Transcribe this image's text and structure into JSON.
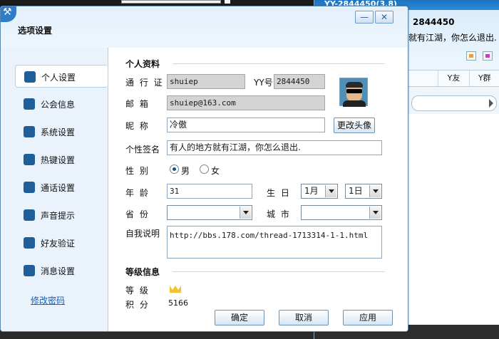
{
  "background": {
    "yy_window": {
      "title": "YY-2844450(3.8)",
      "user_id": "2844450",
      "signature": "就有江湖，你怎么退出.",
      "tabs": [
        "",
        "Y友",
        "Y群"
      ]
    }
  },
  "dialog": {
    "title": "选项设置",
    "minimize_label": "—",
    "close_label": "✕"
  },
  "nav": {
    "items": [
      {
        "label": "个人设置",
        "icon": "person-icon"
      },
      {
        "label": "公会信息",
        "icon": "flag-icon"
      },
      {
        "label": "系统设置",
        "icon": "monitor-icon"
      },
      {
        "label": "热键设置",
        "icon": "key-icon"
      },
      {
        "label": "通话设置",
        "icon": "microphone-icon"
      },
      {
        "label": "声音提示",
        "icon": "speaker-icon"
      },
      {
        "label": "好友验证",
        "icon": "friend-verify-icon"
      },
      {
        "label": "消息设置",
        "icon": "message-icon"
      }
    ],
    "active_index": 0,
    "change_password": "修改密码"
  },
  "profile": {
    "section_title": "个人资料",
    "passport_label": "通 行 证",
    "passport_value": "shuiep",
    "yy_label": "YY号",
    "yy_value": "2844450",
    "email_label": "邮    箱",
    "email_value": "shuiep@163.com",
    "nickname_label": "昵    称",
    "nickname_value": "冷傲",
    "change_avatar_label": "更改头像",
    "signature_label": "个性签名",
    "signature_value": "有人的地方就有江湖，你怎么退出.",
    "gender_label": "性    别",
    "gender_male": "男",
    "gender_female": "女",
    "gender_selected": "男",
    "age_label": "年    龄",
    "age_value": "31",
    "birthday_label": "生  日",
    "birthday_month": "1月",
    "birthday_day": "1日",
    "province_label": "省    份",
    "province_value": "",
    "city_label": "城  市",
    "city_value": "",
    "bio_label": "自我说明",
    "bio_value": "http://bbs.178.com/thread-1713314-1-1.html"
  },
  "level": {
    "section_title": "等级信息",
    "level_label": "等    级",
    "points_label": "积    分",
    "points_value": "5166"
  },
  "buttons": {
    "ok": "确定",
    "cancel": "取消",
    "apply": "应用"
  }
}
